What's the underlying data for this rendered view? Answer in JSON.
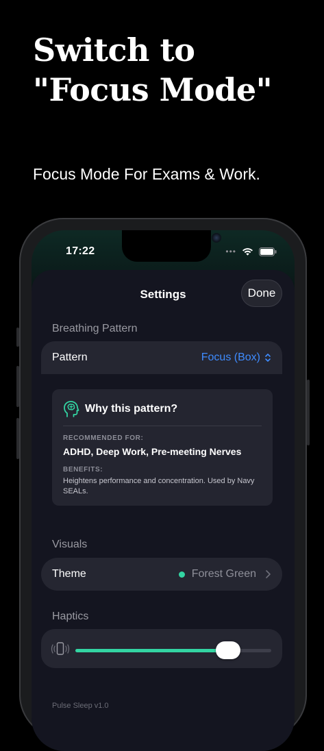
{
  "hero": {
    "title_line1": "Switch to",
    "title_line2": "\"Focus Mode\"",
    "subtitle": "Focus Mode For Exams & Work."
  },
  "status_bar": {
    "time": "17:22",
    "dots": "•••"
  },
  "sheet": {
    "title": "Settings",
    "done_label": "Done"
  },
  "breathing": {
    "section_label": "Breathing Pattern",
    "pattern_label": "Pattern",
    "pattern_value": "Focus (Box)"
  },
  "info": {
    "title": "Why this pattern?",
    "recommended_caption": "RECOMMENDED FOR:",
    "recommended_value": "ADHD, Deep Work, Pre-meeting Nerves",
    "benefits_caption": "BENEFITS:",
    "benefits_value": "Heightens performance and concentration. Used by Navy SEALs."
  },
  "visuals": {
    "section_label": "Visuals",
    "theme_label": "Theme",
    "theme_value": "Forest Green",
    "theme_color": "#33d5a3"
  },
  "haptics": {
    "section_label": "Haptics",
    "intensity": 0.78
  },
  "footer": {
    "version": "Pulse Sleep v1.0"
  },
  "colors": {
    "accent_blue": "#3f8cff",
    "accent_green": "#33d5a3"
  },
  "icons": [
    "head-brain-icon",
    "chevron-updown-icon",
    "chevron-right-icon",
    "vibration-icon",
    "wifi-icon",
    "battery-icon"
  ]
}
